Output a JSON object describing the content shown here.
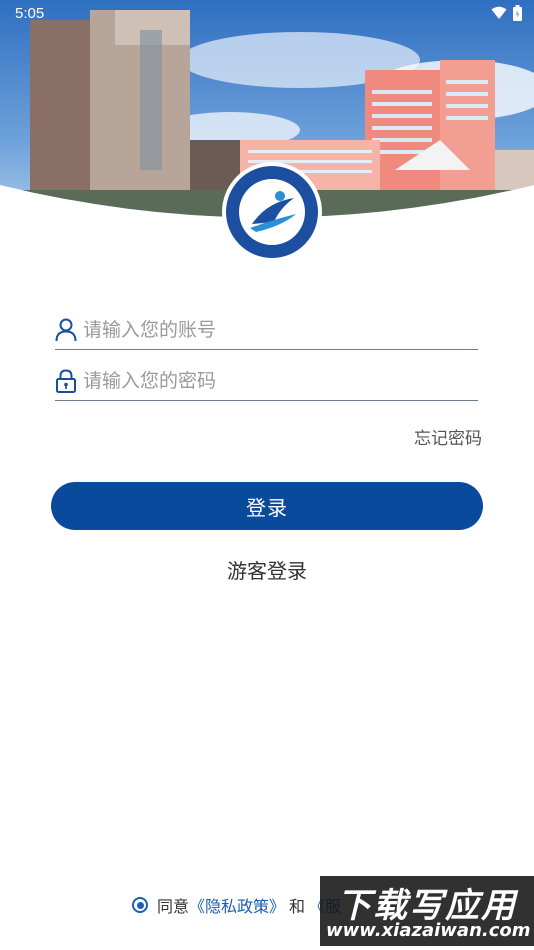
{
  "status_bar": {
    "time": "5:05"
  },
  "login": {
    "account_placeholder": "请输入您的账号",
    "password_placeholder": "请输入您的密码",
    "forgot_password": "忘记密码",
    "login_button": "登录",
    "guest_login": "游客登录"
  },
  "agreement": {
    "prefix": "同意",
    "privacy_policy": "《隐私政策》",
    "conjunction": "和",
    "second_link": "《服"
  },
  "watermark": {
    "main": "下载写应用",
    "url": "www.xiazaiwan.com"
  },
  "colors": {
    "primary": "#0a4a9c",
    "link": "#1a5fb4",
    "divider": "#6d7c92"
  },
  "icons": [
    "person-icon",
    "lock-icon",
    "wifi-icon",
    "battery-icon",
    "school-logo"
  ]
}
